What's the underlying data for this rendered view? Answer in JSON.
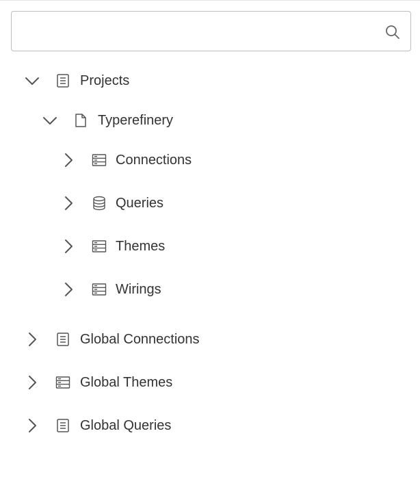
{
  "search": {
    "value": "",
    "placeholder": ""
  },
  "tree": {
    "projects": {
      "label": "Projects",
      "expanded": true,
      "icon": "document-list-icon",
      "children": {
        "typerefinery": {
          "label": "Typerefinery",
          "expanded": true,
          "icon": "file-icon",
          "children": [
            {
              "label": "Connections",
              "icon": "server-icon"
            },
            {
              "label": "Queries",
              "icon": "database-icon"
            },
            {
              "label": "Themes",
              "icon": "server-icon"
            },
            {
              "label": "Wirings",
              "icon": "server-icon"
            }
          ]
        }
      }
    },
    "roots": [
      {
        "label": "Global Connections",
        "icon": "document-list-icon"
      },
      {
        "label": "Global Themes",
        "icon": "server-icon"
      },
      {
        "label": "Global Queries",
        "icon": "document-list-icon"
      }
    ]
  },
  "colors": {
    "text": "#333333",
    "icon": "#555555",
    "border": "#bdbdbd"
  }
}
